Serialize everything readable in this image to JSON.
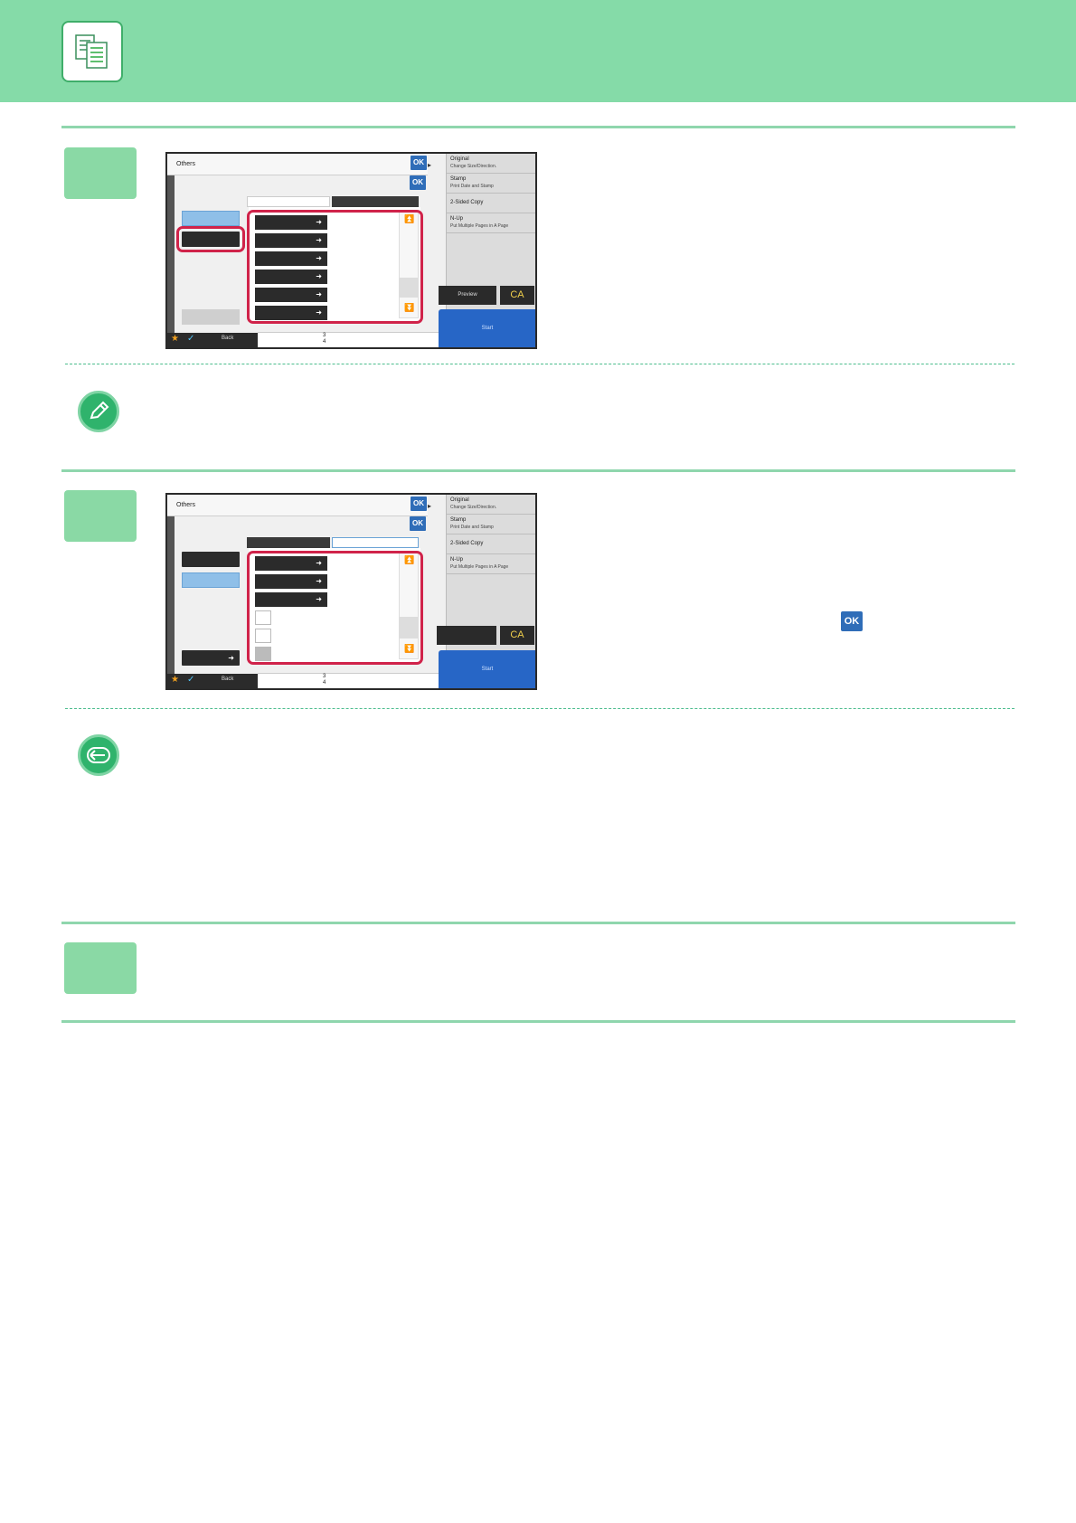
{
  "colors": {
    "header": "#85dba8",
    "rule": "#8fd6ad",
    "step_box": "#8ad9a5",
    "ok_blue": "#2f6db8",
    "highlight_red": "#d0234a"
  },
  "header": {
    "icon": "copy-document-icon"
  },
  "screen1": {
    "title": "Others",
    "ok_label": "OK",
    "right_menu": [
      {
        "title": "Original",
        "sub": "Change Size/Direction."
      },
      {
        "title": "Stamp",
        "sub": "Print Date and Stamp"
      },
      {
        "title": "2-Sided Copy",
        "sub": ""
      },
      {
        "title": "N-Up",
        "sub": "Put Multiple Pages in A Page"
      }
    ],
    "preview_label": "Preview",
    "ca_label": "CA",
    "start_label": "Start",
    "back_label": "Back",
    "counter_top": "3",
    "counter_bottom": "4"
  },
  "screen2": {
    "title": "Others",
    "ok_label": "OK",
    "right_menu": [
      {
        "title": "Original",
        "sub": "Change Size/Direction."
      },
      {
        "title": "Stamp",
        "sub": "Print Date and Stamp"
      },
      {
        "title": "2-Sided Copy",
        "sub": ""
      },
      {
        "title": "N-Up",
        "sub": "Put Multiple Pages in A Page"
      }
    ],
    "ca_label": "CA",
    "start_label": "Start",
    "back_label": "Back",
    "counter_top": "3",
    "counter_bottom": "4"
  },
  "instructions": {
    "ok_icon_label": "OK"
  }
}
